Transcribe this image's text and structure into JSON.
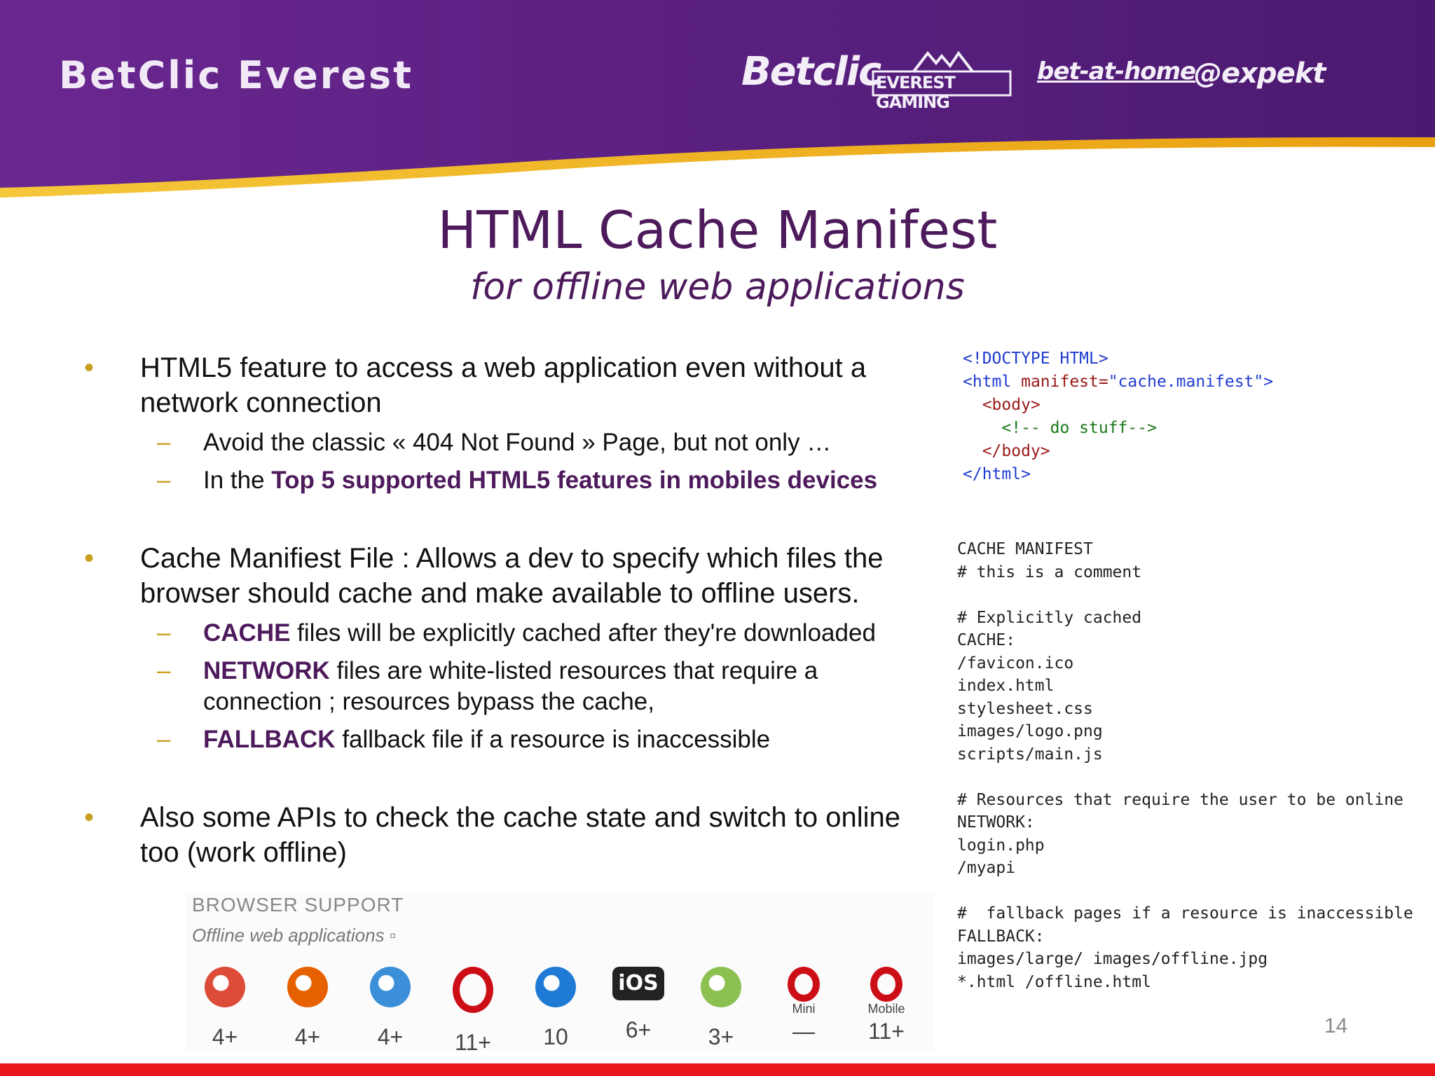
{
  "header": {
    "brand": "BetClic Everest",
    "logos": [
      "Betclic",
      "EVEREST GAMING",
      "bet-at-home",
      "expekt"
    ]
  },
  "slide": {
    "title": "HTML Cache Manifest",
    "subtitle": "for offline web applications",
    "bullets": [
      {
        "text": "HTML5 feature to access a web application even without a network connection",
        "subs": [
          {
            "pre": "",
            "kw": "",
            "text": "Avoid the classic « 404 Not Found » Page, but not only …"
          },
          {
            "pre": "In the ",
            "kw": "Top 5 supported HTML5 features in mobiles devices",
            "text": ""
          }
        ]
      },
      {
        "text": "Cache Manifiest File : Allows a dev to specify which files the browser should cache and make available to offline users.",
        "subs": [
          {
            "pre": "",
            "kw": "CACHE",
            "text": " files will be explicitly cached after they're downloaded"
          },
          {
            "pre": "",
            "kw": "NETWORK",
            "text": " files are white-listed resources that require a connection ; resources bypass the cache,"
          },
          {
            "pre": "",
            "kw": "FALLBACK",
            "text": " fallback file if a resource is inaccessible"
          }
        ]
      },
      {
        "text": "Also some APIs to check the cache state and switch to online too (work offline)",
        "subs": []
      }
    ],
    "page_number": "14"
  },
  "code_html": {
    "line1": "<!DOCTYPE HTML>",
    "line2_tag": "<html ",
    "line2_attr": "manifest=",
    "line2_val": "\"cache.manifest\"",
    "line2_end": ">",
    "line3": "<body>",
    "line4": "<!-- do stuff-->",
    "line5": "</body>",
    "line6": "</html>"
  },
  "code_manifest": "CACHE MANIFEST\n# this is a comment\n\n# Explicitly cached\nCACHE:\n/favicon.ico\nindex.html\nstylesheet.css\nimages/logo.png\nscripts/main.js\n\n# Resources that require the user to be online\nNETWORK:\nlogin.php\n/myapi\n\n#  fallback pages if a resource is inaccessible\nFALLBACK:\nimages/large/ images/offline.jpg\n*.html /offline.html",
  "browser_support": {
    "title": "BROWSER SUPPORT",
    "subtitle": "Offline web applications ▫",
    "browsers": [
      {
        "icon": "chrome-icon",
        "label": "",
        "version": "4+",
        "color": "#dd4b39"
      },
      {
        "icon": "firefox-icon",
        "label": "",
        "version": "4+",
        "color": "#e66000"
      },
      {
        "icon": "safari-icon",
        "label": "",
        "version": "4+",
        "color": "#3a8fd8"
      },
      {
        "icon": "opera-icon",
        "label": "",
        "version": "11+",
        "color": "#cc0f16"
      },
      {
        "icon": "ie-icon",
        "label": "",
        "version": "10",
        "color": "#1e7ad4"
      },
      {
        "icon": "ios-icon",
        "label": "",
        "version": "6+",
        "color": "#222222"
      },
      {
        "icon": "android-icon",
        "label": "",
        "version": "3+",
        "color": "#8cc152"
      },
      {
        "icon": "opera-mini-icon",
        "label": "Mini",
        "version": "—",
        "color": "#cc0f16"
      },
      {
        "icon": "opera-mobile-icon",
        "label": "Mobile",
        "version": "11+",
        "color": "#cc0f16"
      }
    ]
  },
  "colors": {
    "header_purple": "#5e2383",
    "header_gold": "#f2b51a",
    "title_purple": "#4d1a5c",
    "bullet_gold": "#c8a020",
    "footer_red": "#e8151b"
  }
}
